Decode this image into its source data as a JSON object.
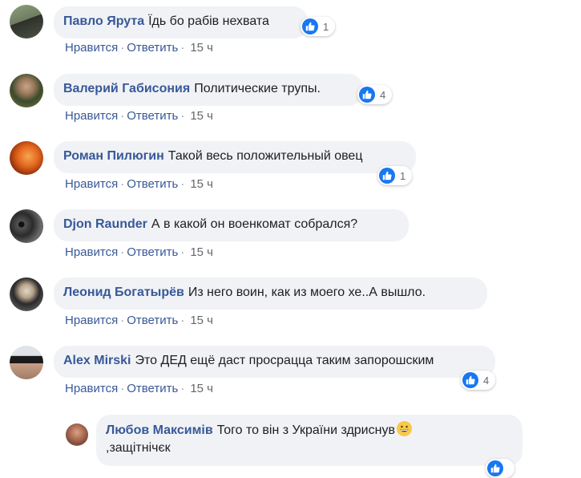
{
  "comments": [
    {
      "author": "Павло Ярута",
      "text": "Їдь бо рабів нехвата",
      "like": "Нравится",
      "reply": "Ответить",
      "time": "15 ч",
      "reactions": "1"
    },
    {
      "author": "Валерий Габисония",
      "text": "Политические трупы.",
      "like": "Нравится",
      "reply": "Ответить",
      "time": "15 ч",
      "reactions": "4"
    },
    {
      "author": "Роман Пилюгин",
      "text": "Такой весь положительный овец",
      "like": "Нравится",
      "reply": "Ответить",
      "time": "15 ч",
      "reactions": "1"
    },
    {
      "author": "Djon Raunder",
      "text": "А в какой он военкомат собрался?",
      "like": "Нравится",
      "reply": "Ответить",
      "time": "15 ч"
    },
    {
      "author": "Леонид Богатырёв",
      "text": "Из него воин, как из моего хе..А вышло.",
      "like": "Нравится",
      "reply": "Ответить",
      "time": "15 ч"
    },
    {
      "author": "Alex Mirski",
      "text": "Это ДЕД ещё даст просрацца таким запорошским",
      "like": "Нравится",
      "reply": "Ответить",
      "time": "15 ч",
      "reactions": "4"
    }
  ],
  "reply": {
    "author": "Любов Максимів",
    "text_line1": "Того то він з України здриснув",
    "text_line2": ",защітнічєк",
    "emoji_icon": "grinning-face-icon"
  },
  "actions_sep": "·",
  "colors": {
    "author": "#385898",
    "bubble": "#f0f2f5",
    "like_blue": "#1877f2",
    "meta": "#65676b"
  }
}
